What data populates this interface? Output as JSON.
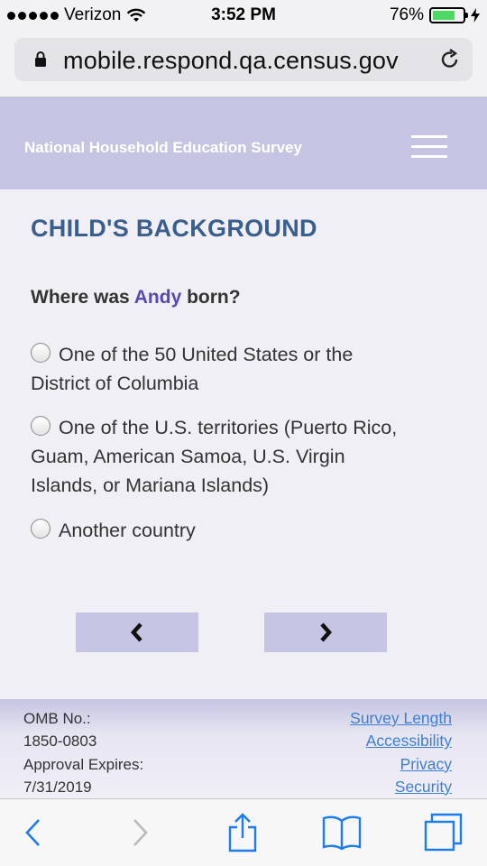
{
  "status_bar": {
    "carrier": "Verizon",
    "time": "3:52 PM",
    "battery_percent": "76%",
    "battery_level": 0.76,
    "icons": [
      "signal-dots-icon",
      "wifi-icon",
      "battery-icon",
      "charging-bolt-icon"
    ]
  },
  "browser": {
    "url": "mobile.respond.qa.census.gov",
    "icons": [
      "lock-icon",
      "reload-icon"
    ]
  },
  "header": {
    "title": "National Household Education Survey",
    "menu_icon": "hamburger-menu-icon"
  },
  "main": {
    "section_title": "CHILD'S BACKGROUND",
    "question": {
      "prefix": "Where was ",
      "child_name": "Andy",
      "suffix": " born?"
    },
    "options": [
      {
        "label": "One of the 50 United States or the District of Columbia",
        "selected": false
      },
      {
        "label": "One of the U.S. territories (Puerto Rico, Guam, American Samoa, U.S. Virgin Islands, or Mariana Islands)",
        "selected": false
      },
      {
        "label": "Another country",
        "selected": false
      }
    ],
    "prev_icon": "chevron-left-icon",
    "next_icon": "chevron-right-icon"
  },
  "footer": {
    "omb_label": "OMB No.:",
    "omb_number": "1850-0803",
    "approval_label": "Approval Expires:",
    "approval_date": "7/31/2019",
    "links": [
      "Survey Length",
      "Accessibility",
      "Privacy",
      "Security"
    ]
  },
  "toolbar": {
    "icons": [
      "back-icon",
      "forward-icon",
      "share-icon",
      "bookmarks-icon",
      "tabs-icon"
    ]
  },
  "colors": {
    "header_bg": "#c5c4e2",
    "section_title": "#3a5f8c",
    "child_name": "#5a48b0",
    "link": "#3d7fd1",
    "ios_blue": "#1a7cf0"
  }
}
